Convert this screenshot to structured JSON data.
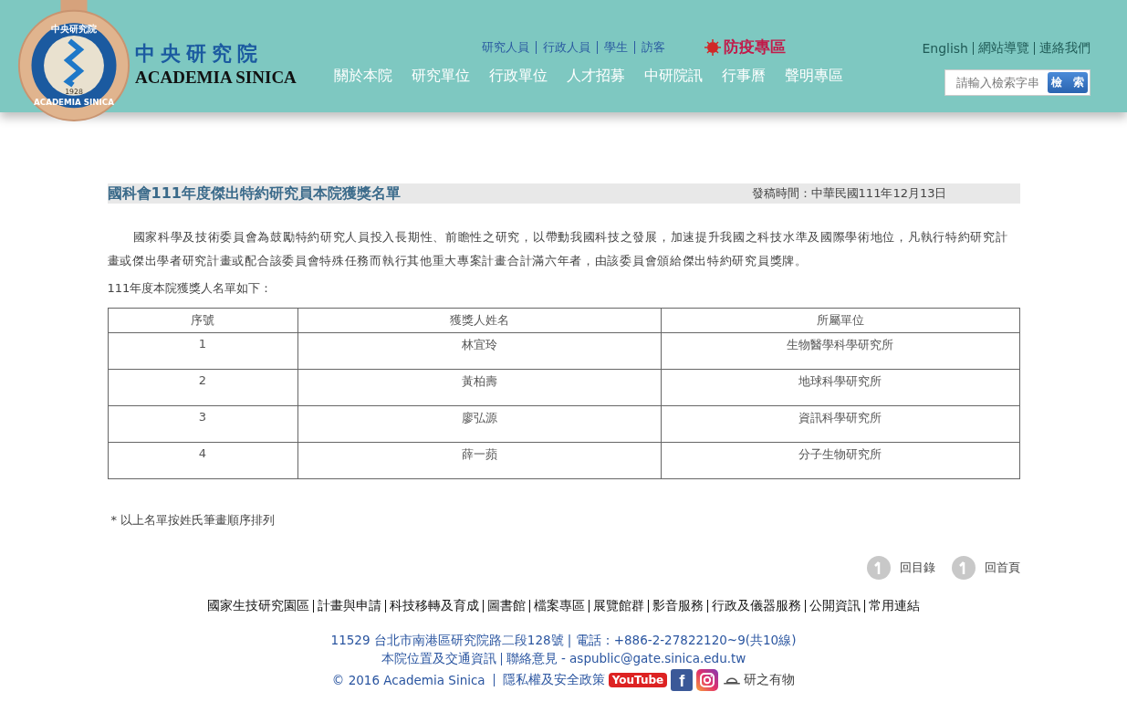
{
  "header": {
    "seal": {
      "top": "中央研究院",
      "bottom": "ACADEMIA SINICA",
      "year": "1928"
    },
    "logo": {
      "chinese": "中央研究院",
      "english": "ACADEMIA SINICA"
    },
    "audience_links": [
      "研究人員",
      "行政人員",
      "學生",
      "訪客"
    ],
    "epidemic_link": "防疫專區",
    "utility_links": [
      "English",
      "網站導覽",
      "連絡我們"
    ],
    "nav": [
      "關於本院",
      "研究單位",
      "行政單位",
      "人才招募",
      "中研院訊",
      "行事曆",
      "聲明專區"
    ],
    "search": {
      "placeholder": "請輸入檢索字串",
      "button": "檢　索"
    }
  },
  "article": {
    "title": "國科會111年度傑出特約研究員本院獲獎名單",
    "date": "發稿時間：中華民國111年12月13日",
    "paragraph": "國家科學及技術委員會為鼓勵特約研究人員投入長期性、前瞻性之研究，以帶動我國科技之發展，加速提升我國之科技水準及國際學術地位，凡執行特約研究計畫或傑出學者研究計畫或配合該委員會特殊任務而執行其他重大專案計畫合計滿六年者，由該委員會頒給傑出特約研究員獎牌。",
    "list_intro": "111年度本院獲獎人名單如下：",
    "table": {
      "columns": [
        "序號",
        "獲獎人姓名",
        "所屬單位"
      ],
      "rows": [
        [
          "1",
          "林宜玲",
          "生物醫學科學研究所"
        ],
        [
          "2",
          "黃柏壽",
          "地球科學研究所"
        ],
        [
          "3",
          "廖弘源",
          "資訊科學研究所"
        ],
        [
          "4",
          "薛一蘋",
          "分子生物研究所"
        ]
      ]
    },
    "note": "* 以上名單按姓氏筆畫順序排列",
    "back_links": [
      "回目錄",
      "回首頁"
    ]
  },
  "footer": {
    "links": [
      "國家生技研究園區",
      "計畫與申請",
      "科技移轉及育成",
      "圖書館",
      "檔案專區",
      "展覽館群",
      "影音服務",
      "行政及儀器服務",
      "公開資訊",
      "常用連結"
    ],
    "address": "11529 台北市南港區研究院路二段128號 | 電話：+886-2-27822120~9(共10線)",
    "location_link": "本院位置及交通資訊",
    "feedback": "聯絡意見 - aspublic@gate.sinica.edu.tw",
    "copyright": "© 2016 Academia Sinica",
    "privacy_link": "隱私權及安全政策",
    "youtube": "YouTube",
    "facebook": "f",
    "research_link": "研之有物"
  }
}
